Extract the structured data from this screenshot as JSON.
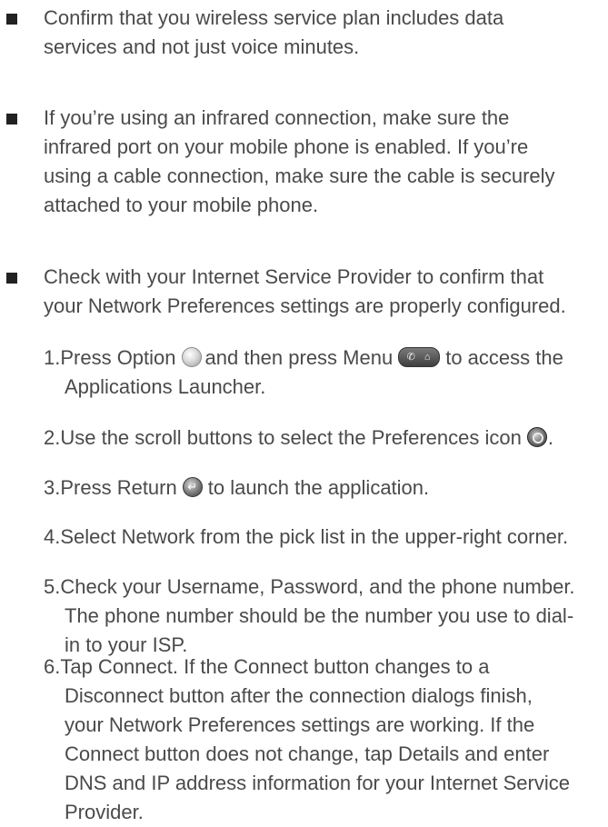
{
  "bullets": [
    {
      "lines": [
        "Confirm that you wireless service plan includes data",
        "services and not just voice minutes."
      ]
    },
    {
      "lines": [
        "If you’re using an infrared connection, make sure the",
        "infrared port on your mobile phone is enabled. If you’re",
        "using a cable connection, make sure the cable is securely",
        "attached to your mobile phone."
      ]
    },
    {
      "lines": [
        "Check with your Internet Service Provider to confirm that",
        "your Network Preferences settings are properly configured."
      ]
    }
  ],
  "steps": {
    "s1": {
      "a": "1.Press Option",
      "b": "and then press Menu",
      "c": "to access the",
      "line2": "Applications Launcher."
    },
    "s2": {
      "a": "2.Use the scroll buttons to select the Preferences icon",
      "b": "."
    },
    "s3": {
      "a": "3.Press Return",
      "b": "to launch the application."
    },
    "s4": {
      "line1": "4.Select Network from the pick list in the upper-right corner."
    },
    "s5": {
      "lines": [
        "5.Check your Username, Password, and the phone number.",
        "The phone number should be the number you use to dial-",
        "in to your ISP."
      ]
    },
    "s6": {
      "lines": [
        "6.Tap Connect. If the Connect button changes to a",
        "Disconnect button after the connection dialogs finish,",
        "your Network Preferences settings are working. If the",
        "Connect button does not change, tap Details and enter",
        "DNS and IP address information for your Internet Service",
        "Provider."
      ]
    }
  },
  "icons": {
    "option": "option-key-icon",
    "menu": "menu-key-icon",
    "preferences": "preferences-icon",
    "return": "return-key-icon"
  },
  "colors": {
    "text": "#4a4a4a",
    "bullet": "#222222"
  }
}
